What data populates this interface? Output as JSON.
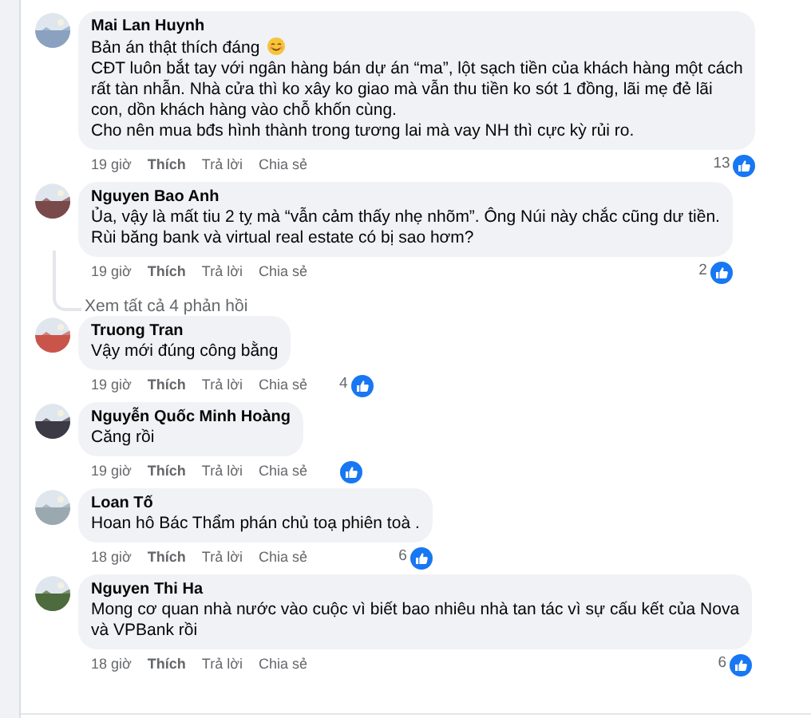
{
  "comments": [
    {
      "author": "Mai Lan Huynh",
      "lines": [
        {
          "text": "Bản án thật thích đáng",
          "emoji": true
        },
        {
          "text": "CĐT luôn bắt tay với ngân hàng bán dự án “ma”, lột sạch tiền của khách hàng một cách",
          "emoji": false
        },
        {
          "text": "rất tàn nhẫn. Nhà cửa thì ko xây ko giao mà vẫn thu tiền ko sót 1 đồng, lãi mẹ đẻ lãi",
          "emoji": false
        },
        {
          "text": "con, dồn khách hàng vào chỗ khốn cùng.",
          "emoji": false
        },
        {
          "text": "Cho nên mua bđs hình thành trong tương lai mà vay NH thì cực kỳ rủi ro.",
          "emoji": false
        }
      ],
      "time": "19 giờ",
      "actions": [
        "Thích",
        "Trả lời",
        "Chia sẻ"
      ],
      "likes": "13"
    },
    {
      "author": "Nguyen Bao Anh",
      "lines": [
        {
          "text": "Ủa, vậy là mất tiu 2 tỵ mà “vẫn cảm thấy nhẹ nhõm”. Ông Núi này chắc cũng dư tiền.",
          "emoji": false
        },
        {
          "text": "Rùi băng bank và virtual real estate có bị sao hơm?",
          "emoji": false
        }
      ],
      "time": "19 giờ",
      "actions": [
        "Thích",
        "Trả lời",
        "Chia sẻ"
      ],
      "likes": "2",
      "more_replies": "Xem tất cả 4 phản hồi"
    },
    {
      "author": "Truong Tran",
      "lines": [
        {
          "text": "Vậy mới đúng công bằng",
          "emoji": false
        }
      ],
      "time": "19 giờ",
      "actions": [
        "Thích",
        "Trả lời",
        "Chia sẻ"
      ],
      "likes": "4"
    },
    {
      "author": "Nguyễn Quốc Minh Hoàng",
      "lines": [
        {
          "text": "Căng rồi",
          "emoji": false
        }
      ],
      "time": "19 giờ",
      "actions": [
        "Thích",
        "Trả lời",
        "Chia sẻ"
      ]
    },
    {
      "author": "Loan Tố",
      "lines": [
        {
          "text": "Hoan hô Bác Thẩm phán chủ toạ phiên toà .",
          "emoji": false
        }
      ],
      "time": "18 giờ",
      "actions": [
        "Thích",
        "Trả lời",
        "Chia sẻ"
      ],
      "likes": "6"
    },
    {
      "author": "Nguyen Thi Ha",
      "lines": [
        {
          "text": "Mong cơ quan nhà nước vào cuộc vì biết bao nhiêu nhà tan tác vì sự cấu kết của Nova",
          "emoji": false
        },
        {
          "text": "và VPBank rồi",
          "emoji": false
        }
      ],
      "time": "18 giờ",
      "actions": [
        "Thích",
        "Trả lời",
        "Chia sẻ"
      ],
      "likes": "6"
    }
  ]
}
